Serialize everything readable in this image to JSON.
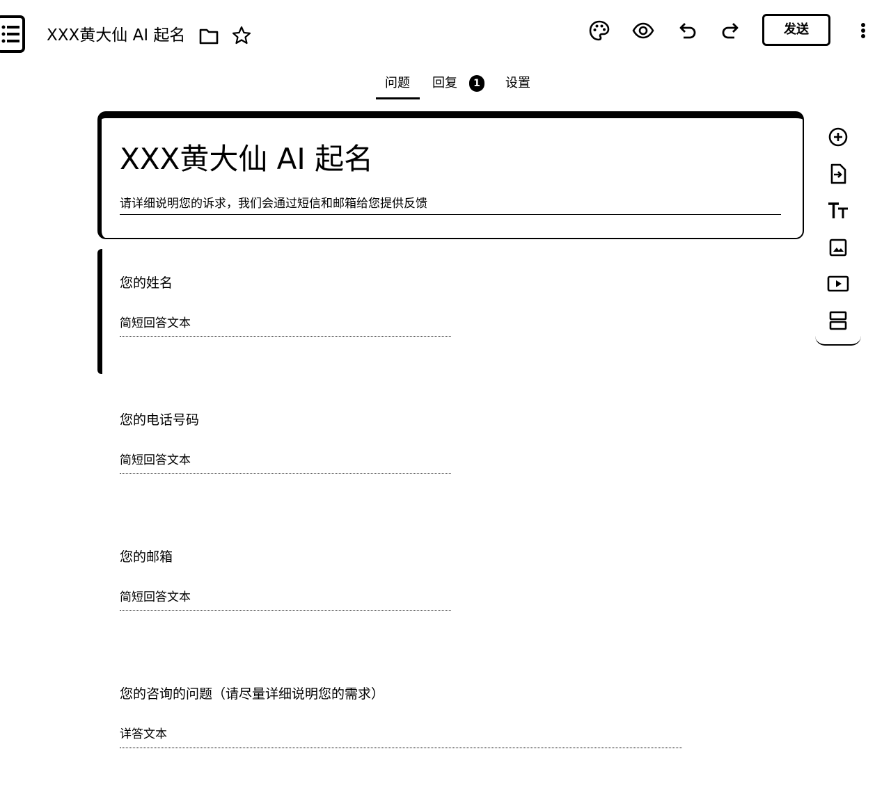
{
  "header": {
    "doc_title": "XXX黄大仙 AI 起名",
    "send_label": "发送",
    "icons": [
      "forms-app-icon",
      "folder-icon",
      "star-icon",
      "palette-icon",
      "preview-eye-icon",
      "undo-icon",
      "redo-icon",
      "more-vert-icon"
    ]
  },
  "tabs": [
    {
      "label": "问题",
      "active": true
    },
    {
      "label": "回复",
      "badge": "1"
    },
    {
      "label": "设置"
    }
  ],
  "form": {
    "title": "XXX黄大仙 AI 起名",
    "description": "请详细说明您的诉求，我们会通过短信和邮箱给您提供反馈"
  },
  "questions": [
    {
      "title": "您的姓名",
      "hint": "简短回答文本"
    },
    {
      "title": "您的电话号码",
      "hint": "简短回答文本"
    },
    {
      "title": "您的邮箱",
      "hint": "简短回答文本"
    },
    {
      "title": "您的咨询的问题（请尽量详细说明您的需求）",
      "hint": "详答文本"
    }
  ],
  "side_toolbar": [
    "add-question-icon",
    "import-questions-icon",
    "add-title-icon",
    "add-image-icon",
    "add-video-icon",
    "add-section-icon"
  ]
}
